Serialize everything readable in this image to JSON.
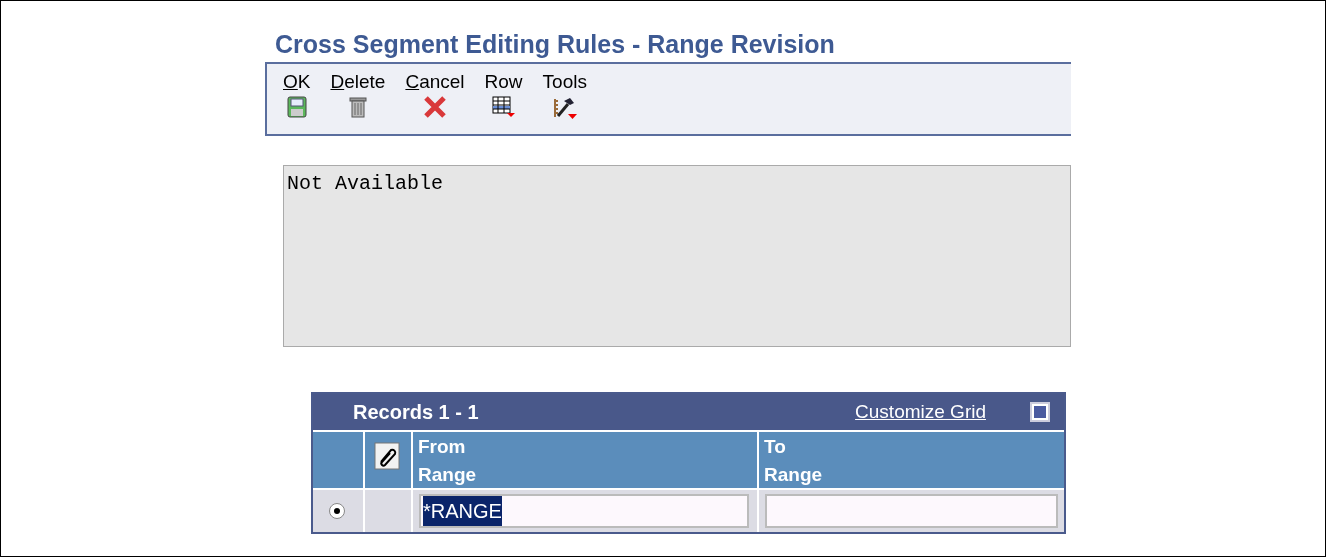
{
  "window": {
    "title": "Cross Segment Editing Rules - Range Revision"
  },
  "toolbar": [
    {
      "label": "OK",
      "underline_first": true,
      "kind": "save"
    },
    {
      "label": "Delete",
      "underline_first": true,
      "kind": "trash"
    },
    {
      "label": "Cancel",
      "underline_first": true,
      "kind": "cancel"
    },
    {
      "label": "Row",
      "underline_first": false,
      "kind": "grid"
    },
    {
      "label": "Tools",
      "underline_first": false,
      "kind": "tools"
    }
  ],
  "text_area": {
    "value": "Not Available"
  },
  "grid": {
    "title": "Records 1 - 1",
    "customize_link": "Customize Grid",
    "columns": [
      "From\nRange",
      "To\nRange"
    ],
    "rows": [
      {
        "selected": true,
        "from_range": "*RANGE",
        "to_range": ""
      }
    ]
  }
}
